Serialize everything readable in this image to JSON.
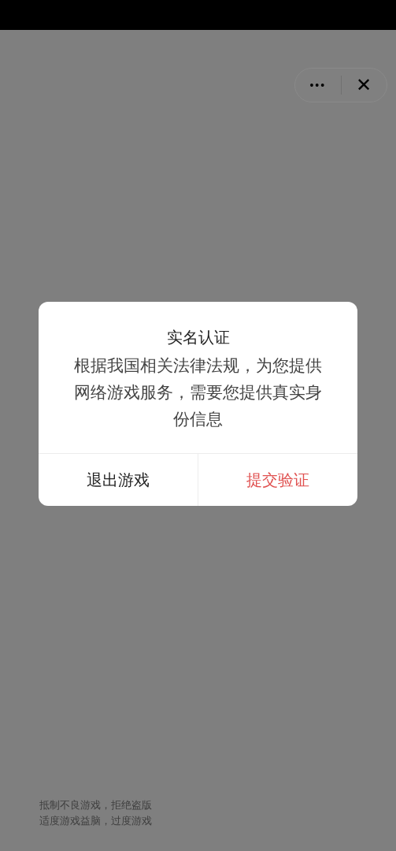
{
  "capsule": {
    "more": "•••",
    "close": "✕"
  },
  "dialog": {
    "title": "实名认证",
    "message": "根据我国相关法律法规，为您提供网络游戏服务，需要您提供真实身份信息",
    "buttons": [
      {
        "label": "退出游戏",
        "kind": "cancel"
      },
      {
        "label": "提交验证",
        "kind": "confirm"
      }
    ]
  },
  "footer": [
    "抵制不良游戏，拒绝盗版",
    "适度游戏益脑，过度游戏"
  ]
}
